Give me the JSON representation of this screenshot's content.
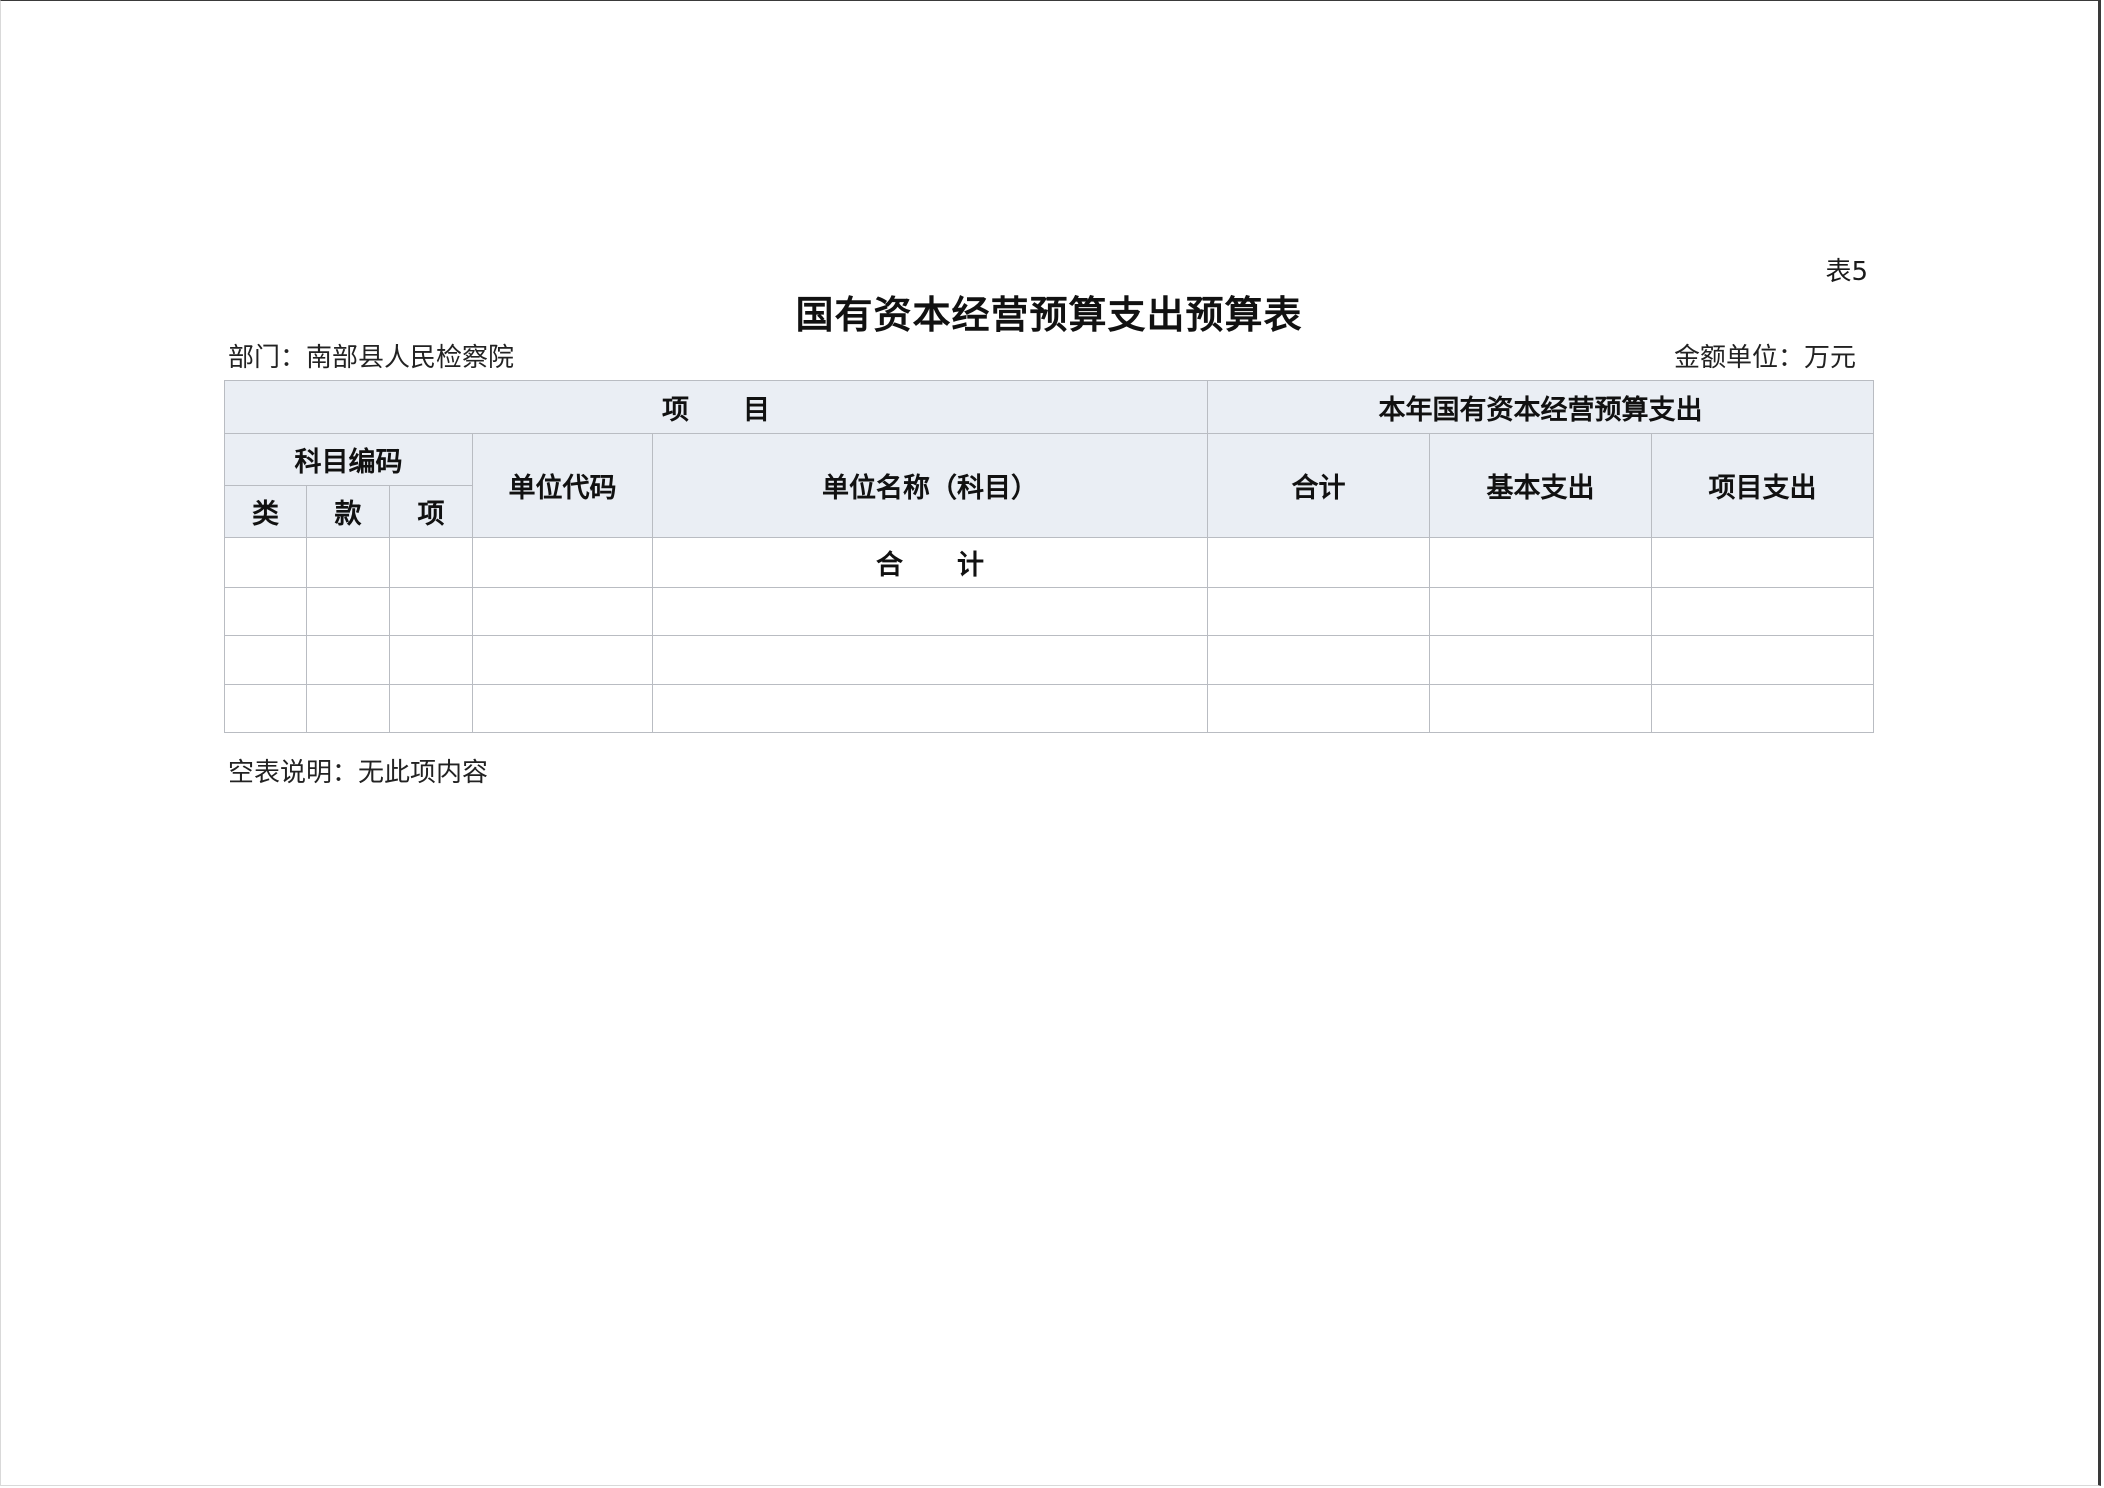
{
  "table_number": "表5",
  "title": "国有资本经营预算支出预算表",
  "department": "部门：南部县人民检察院",
  "amount_unit": "金额单位：万元",
  "table": {
    "header_items": "项　　目",
    "header_expenditure": "本年国有资本经营预算支出",
    "subject_code": "科目编码",
    "unit_code": "单位代码",
    "unit_name": "单位名称（科目）",
    "total": "合计",
    "basic_expenditure": "基本支出",
    "project_expenditure": "项目支出",
    "col_category": "类",
    "col_section": "款",
    "col_item": "项",
    "total_row_label": "合　　计",
    "rows": [
      [
        "",
        "",
        "",
        "",
        "合　　计",
        "",
        "",
        ""
      ],
      [
        "",
        "",
        "",
        "",
        "",
        "",
        "",
        ""
      ],
      [
        "",
        "",
        "",
        "",
        "",
        "",
        "",
        ""
      ],
      [
        "",
        "",
        "",
        "",
        "",
        "",
        "",
        ""
      ]
    ]
  },
  "footnote": "空表说明：无此项内容"
}
